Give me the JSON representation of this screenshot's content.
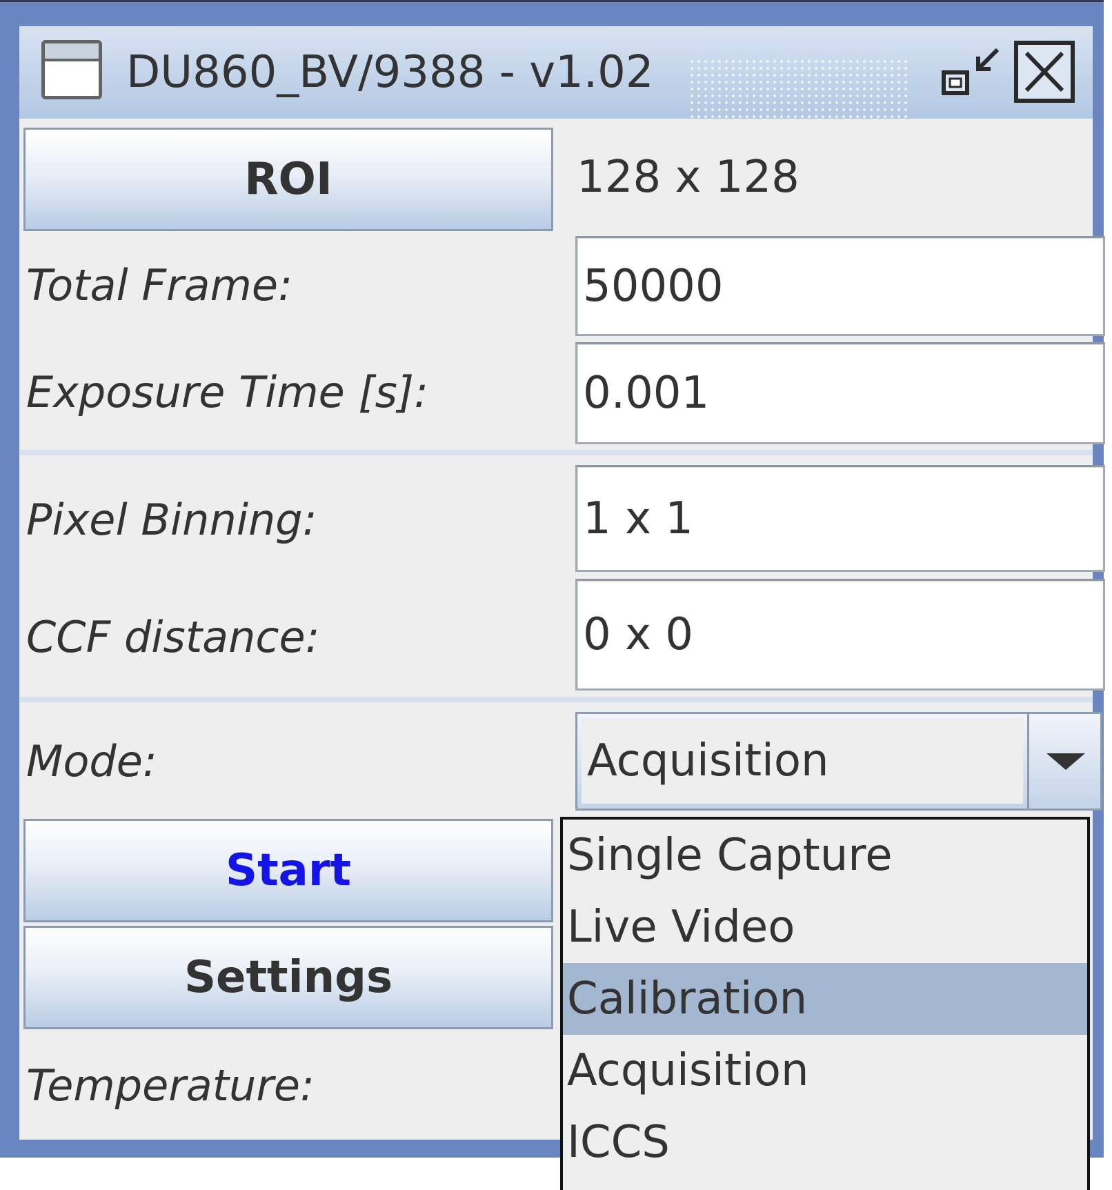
{
  "window": {
    "title": "DU860_BV/9388 - v1.02",
    "icons": [
      "app-window-icon",
      "iconify-icon",
      "close-icon"
    ]
  },
  "roi": {
    "button_label": "ROI",
    "value": "128 x 128"
  },
  "fields": {
    "total_frame": {
      "label": "Total Frame:",
      "value": "50000"
    },
    "exposure_time": {
      "label": "Exposure Time [s]:",
      "value": "0.001"
    },
    "pixel_binning": {
      "label": "Pixel Binning:",
      "value": "1 x 1"
    },
    "ccf_distance": {
      "label": "CCF distance:",
      "value": "0 x 0"
    }
  },
  "mode": {
    "label": "Mode:",
    "selected": "Acquisition",
    "options": [
      "Single Capture",
      "Live Video",
      "Calibration",
      "Acquisition",
      "ICCS"
    ],
    "highlighted_option": "Calibration"
  },
  "actions": {
    "start_label": "Start",
    "start_color": "#1414e6",
    "settings_label": "Settings"
  },
  "temperature": {
    "label": "Temperature:"
  },
  "colors": {
    "window_frame": "#6a86c0",
    "titlebar": "#c4d5ea",
    "highlight": "#a3b8d0"
  }
}
